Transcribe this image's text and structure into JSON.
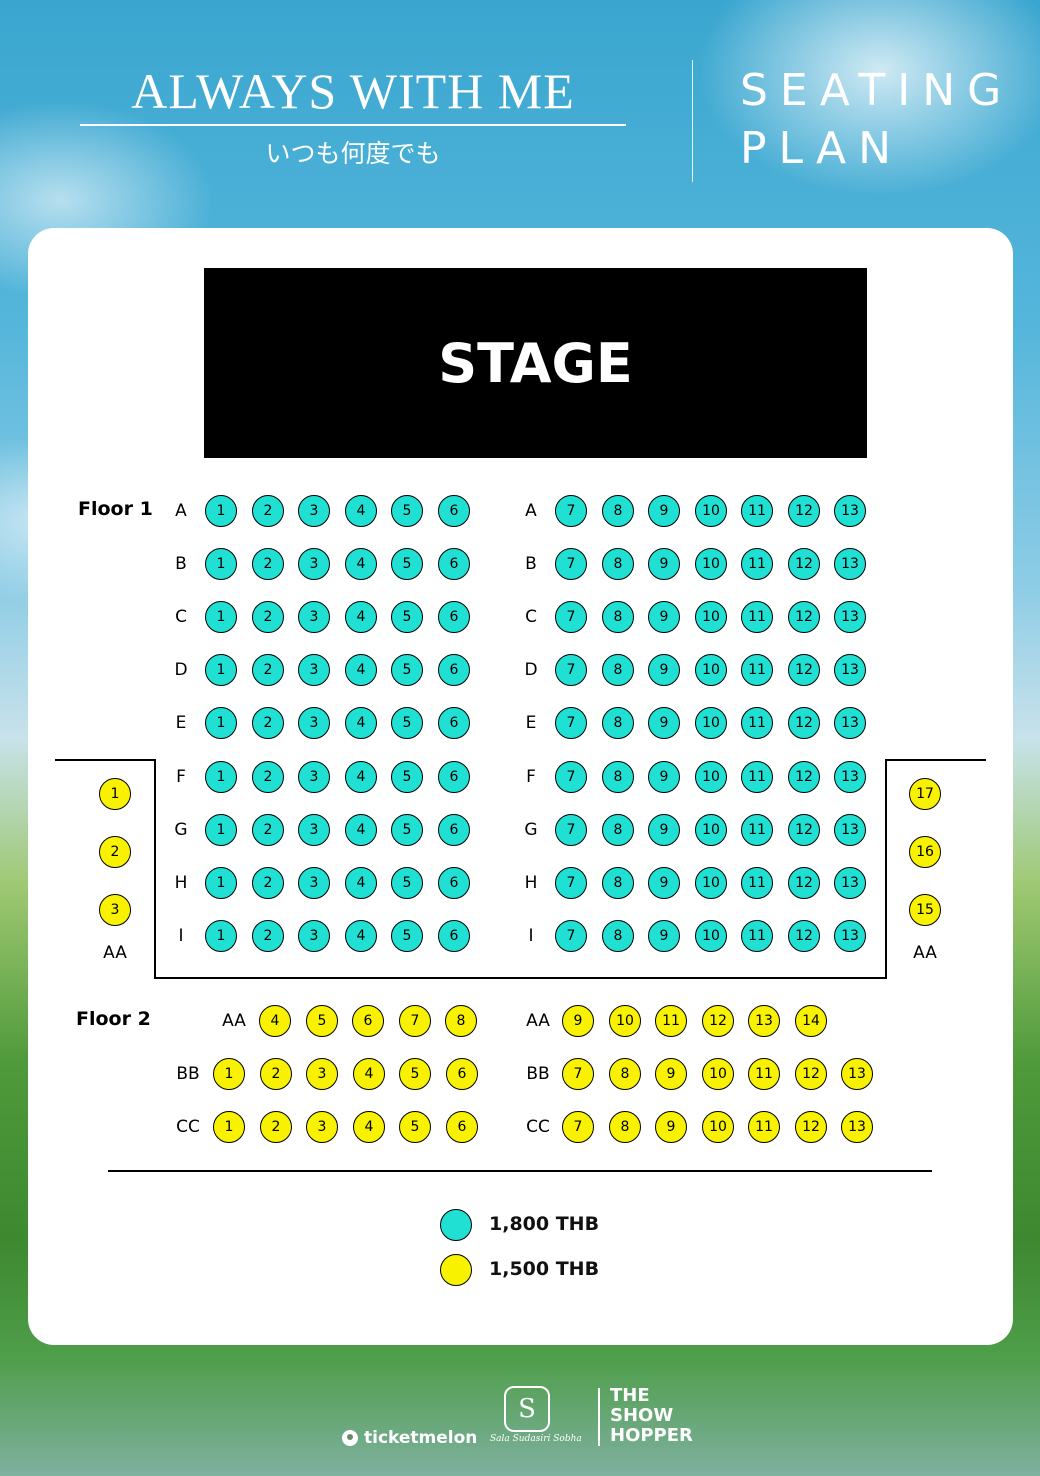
{
  "header": {
    "title": "ALWAYS WITH ME",
    "subtitle": "いつも何度でも",
    "plan_line1": "SEATING",
    "plan_line2": "PLAN"
  },
  "stage_label": "STAGE",
  "floor1": {
    "label": "Floor 1",
    "rows": [
      "A",
      "B",
      "C",
      "D",
      "E",
      "F",
      "G",
      "H",
      "I"
    ],
    "left_seats": [
      "1",
      "2",
      "3",
      "4",
      "5",
      "6"
    ],
    "right_seats": [
      "7",
      "8",
      "9",
      "10",
      "11",
      "12",
      "13"
    ],
    "side_left": {
      "seats": [
        "1",
        "2",
        "3"
      ],
      "row_label": "AA"
    },
    "side_right": {
      "seats": [
        "17",
        "16",
        "15"
      ],
      "row_label": "AA"
    }
  },
  "floor2": {
    "label": "Floor 2",
    "rows": [
      {
        "label": "AA",
        "left": [
          "4",
          "5",
          "6",
          "7",
          "8"
        ],
        "right": [
          "9",
          "10",
          "11",
          "12",
          "13",
          "14"
        ]
      },
      {
        "label": "BB",
        "left": [
          "1",
          "2",
          "3",
          "4",
          "5",
          "6"
        ],
        "right": [
          "7",
          "8",
          "9",
          "10",
          "11",
          "12",
          "13"
        ]
      },
      {
        "label": "CC",
        "left": [
          "1",
          "2",
          "3",
          "4",
          "5",
          "6"
        ],
        "right": [
          "7",
          "8",
          "9",
          "10",
          "11",
          "12",
          "13"
        ]
      }
    ]
  },
  "legend": [
    {
      "color": "#1fe0d2",
      "label": "1,800 THB"
    },
    {
      "color": "#f8f200",
      "label": "1,500 THB"
    }
  ],
  "colors": {
    "tier1": "#1fe0d2",
    "tier2": "#f8f200"
  },
  "sponsors": {
    "ticketmelon": "ticketmelon",
    "sala": "Sala Sudasiri Sobha",
    "showhopper_line1": "THE",
    "showhopper_line2": "SHOW",
    "showhopper_line3": "HOPPER"
  }
}
